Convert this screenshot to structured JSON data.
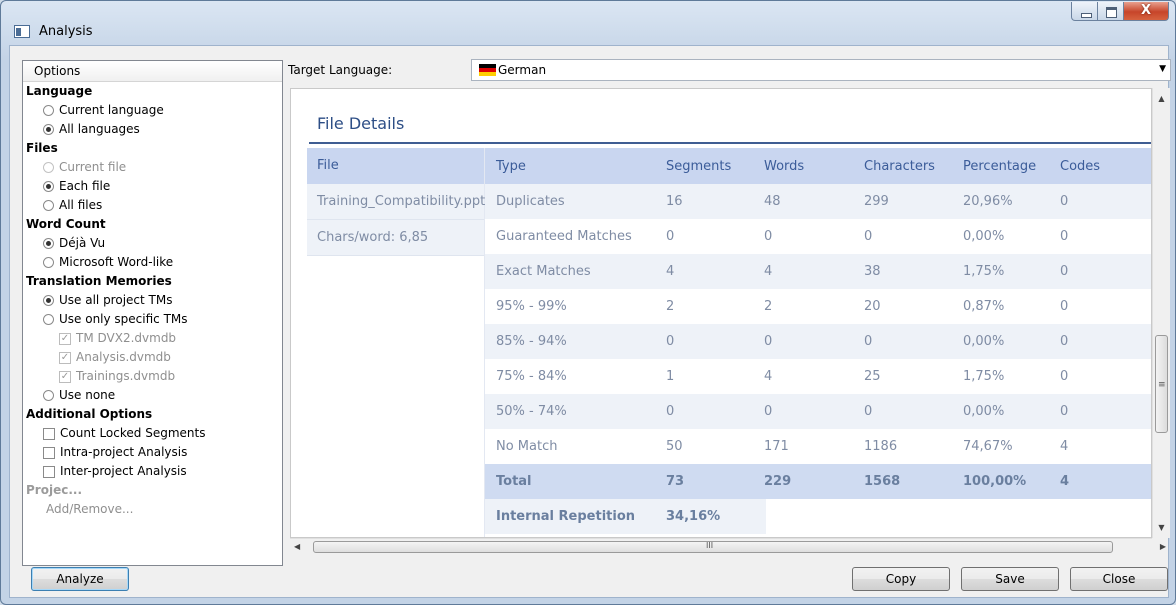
{
  "window": {
    "title": "Analysis",
    "close_glyph": "X"
  },
  "options": {
    "header": "Options",
    "sections": [
      {
        "title": "Language",
        "items": [
          {
            "type": "radio",
            "label": "Current language",
            "checked": false,
            "disabled": false
          },
          {
            "type": "radio",
            "label": "All languages",
            "checked": true,
            "disabled": false
          }
        ]
      },
      {
        "title": "Files",
        "items": [
          {
            "type": "radio",
            "label": "Current file",
            "checked": false,
            "disabled": true
          },
          {
            "type": "radio",
            "label": "Each file",
            "checked": true,
            "disabled": false
          },
          {
            "type": "radio",
            "label": "All files",
            "checked": false,
            "disabled": false
          }
        ]
      },
      {
        "title": "Word Count",
        "items": [
          {
            "type": "radio",
            "label": "Déjà Vu",
            "checked": true,
            "disabled": false
          },
          {
            "type": "radio",
            "label": "Microsoft Word-like",
            "checked": false,
            "disabled": false
          }
        ]
      },
      {
        "title": "Translation Memories",
        "items": [
          {
            "type": "radio",
            "label": "Use all project TMs",
            "checked": true,
            "disabled": false
          },
          {
            "type": "radio",
            "label": "Use only specific TMs",
            "checked": false,
            "disabled": false
          },
          {
            "type": "check",
            "label": "TM DVX2.dvmdb",
            "checked": true,
            "disabled": true,
            "indent": 2
          },
          {
            "type": "check",
            "label": "Analysis.dvmdb",
            "checked": true,
            "disabled": true,
            "indent": 2
          },
          {
            "type": "check",
            "label": "Trainings.dvmdb",
            "checked": true,
            "disabled": true,
            "indent": 2
          },
          {
            "type": "radio",
            "label": "Use none",
            "checked": false,
            "disabled": false
          }
        ]
      },
      {
        "title": "Additional Options",
        "items": [
          {
            "type": "check",
            "label": "Count Locked Segments",
            "checked": false,
            "disabled": false
          },
          {
            "type": "check",
            "label": "Intra-project Analysis",
            "checked": false,
            "disabled": false
          },
          {
            "type": "check",
            "label": "Inter-project Analysis",
            "checked": false,
            "disabled": false
          }
        ]
      }
    ],
    "project_section": "Projec...",
    "add_remove": "Add/Remove..."
  },
  "target": {
    "label": "Target Language:",
    "value": "German",
    "flag_colors": [
      "#000000",
      "#dd0000",
      "#ffce00"
    ]
  },
  "report": {
    "title": "File Details",
    "file_header": "File",
    "file_name": "Training_Compatibility.ppt",
    "chars_per_word": "Chars/word: 6,85",
    "headers": [
      "Type",
      "Segments",
      "Words",
      "Characters",
      "Percentage",
      "Codes"
    ],
    "rows": [
      [
        "Duplicates",
        "16",
        "48",
        "299",
        "20,96%",
        "0"
      ],
      [
        "Guaranteed Matches",
        "0",
        "0",
        "0",
        "0,00%",
        "0"
      ],
      [
        "Exact Matches",
        "4",
        "4",
        "38",
        "1,75%",
        "0"
      ],
      [
        "95% - 99%",
        "2",
        "2",
        "20",
        "0,87%",
        "0"
      ],
      [
        "85% - 94%",
        "0",
        "0",
        "0",
        "0,00%",
        "0"
      ],
      [
        "75% - 84%",
        "1",
        "4",
        "25",
        "1,75%",
        "0"
      ],
      [
        "50% - 74%",
        "0",
        "0",
        "0",
        "0,00%",
        "0"
      ],
      [
        "No Match",
        "50",
        "171",
        "1186",
        "74,67%",
        "4"
      ]
    ],
    "total": [
      "Total",
      "73",
      "229",
      "1568",
      "100,00%",
      "4"
    ],
    "internal_repetition": {
      "label": "Internal Repetition",
      "value": "34,16%"
    }
  },
  "buttons": {
    "analyze": "Analyze",
    "copy": "Copy",
    "save": "Save",
    "close": "Close"
  }
}
